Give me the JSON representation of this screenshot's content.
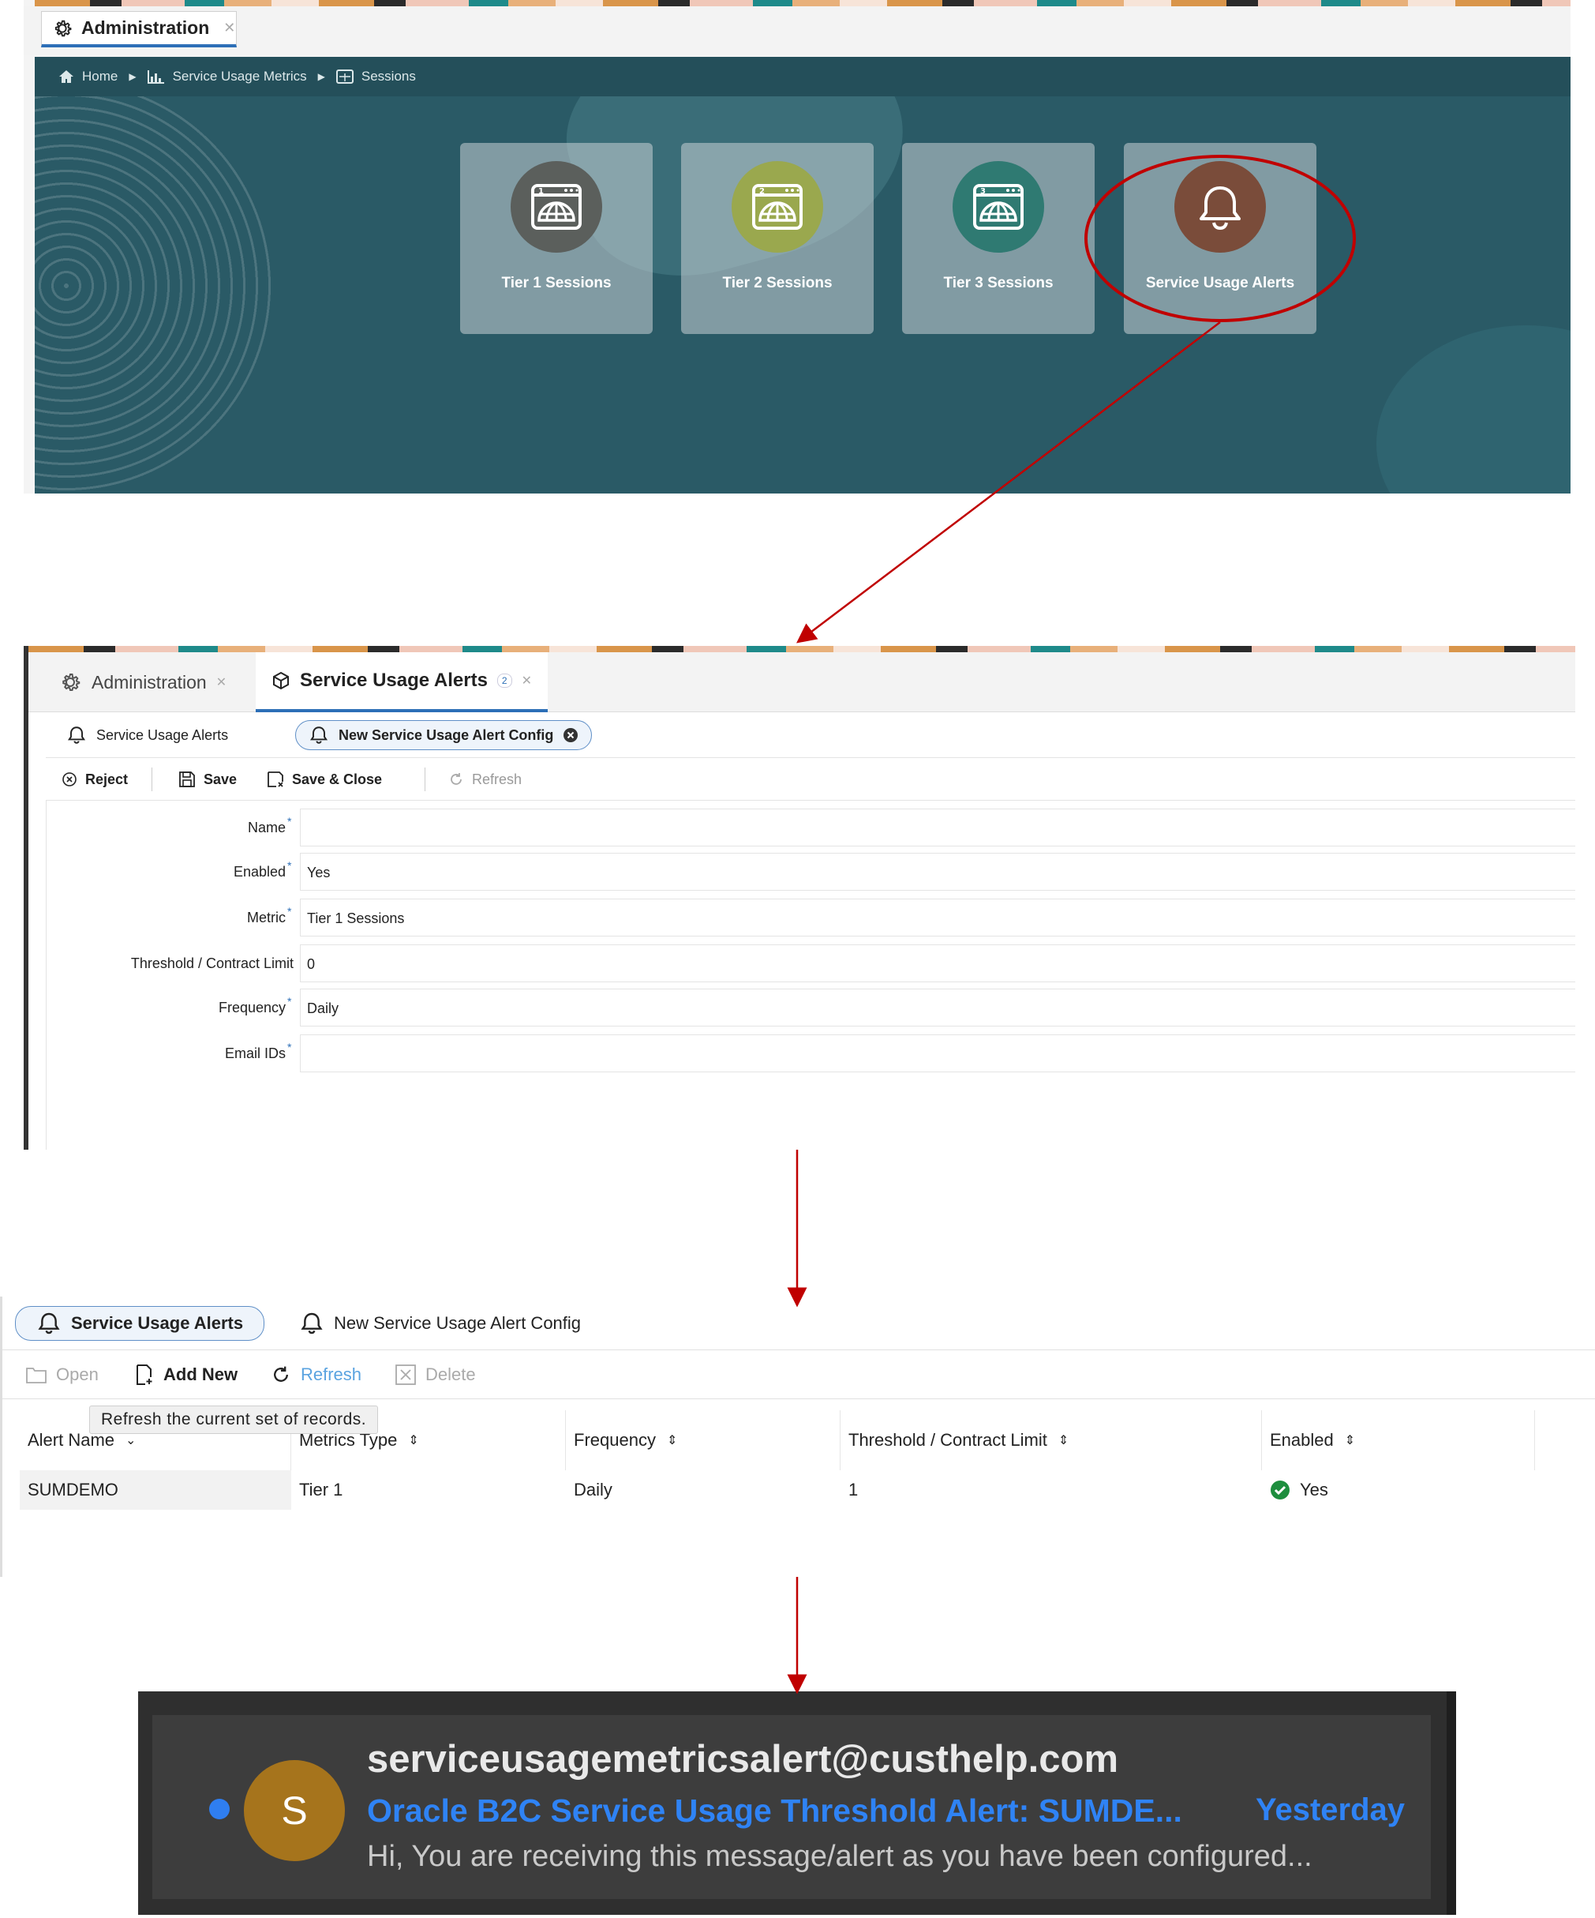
{
  "panel1": {
    "tab_label": "Administration",
    "breadcrumb": [
      "Home",
      "Service Usage Metrics",
      "Sessions"
    ],
    "tiles": [
      {
        "label": "Tier 1 Sessions",
        "color": "#5b5f5c",
        "badge": "1"
      },
      {
        "label": "Tier 2 Sessions",
        "color": "#9aa84e",
        "badge": "2"
      },
      {
        "label": "Tier 3 Sessions",
        "color": "#2f7a72",
        "badge": "3"
      },
      {
        "label": "Service Usage Alerts",
        "color": "#7a4c3a",
        "badge": ""
      }
    ]
  },
  "panel2": {
    "tabs": {
      "admin": "Administration",
      "alerts": "Service Usage Alerts",
      "alerts_count": "2"
    },
    "subtabs": {
      "list": "Service Usage Alerts",
      "new": "New Service Usage Alert Config"
    },
    "toolbar": {
      "reject": "Reject",
      "save": "Save",
      "save_close": "Save & Close",
      "refresh": "Refresh"
    },
    "form": [
      {
        "label": "Name",
        "value": "",
        "required": true
      },
      {
        "label": "Enabled",
        "value": "Yes",
        "required": true
      },
      {
        "label": "Metric",
        "value": "Tier 1 Sessions",
        "required": true
      },
      {
        "label": "Threshold / Contract Limit",
        "value": "0",
        "required": false
      },
      {
        "label": "Frequency",
        "value": "Daily",
        "required": true
      },
      {
        "label": "Email IDs",
        "value": "",
        "required": true
      }
    ]
  },
  "panel3": {
    "subtabs": {
      "list": "Service Usage Alerts",
      "new": "New Service Usage Alert Config"
    },
    "toolbar": {
      "open": "Open",
      "add_new": "Add New",
      "refresh": "Refresh",
      "delete": "Delete"
    },
    "tooltip": "Refresh the current set of records.",
    "columns": [
      "Alert Name",
      "Metrics Type",
      "Frequency",
      "Threshold / Contract Limit",
      "Enabled"
    ],
    "rows": [
      {
        "alert_name": "SUMDEMO",
        "metrics_type": "Tier 1",
        "frequency": "Daily",
        "threshold": "1",
        "enabled": "Yes"
      }
    ]
  },
  "email": {
    "avatar_letter": "S",
    "sender": "serviceusagemetricsalert@custhelp.com",
    "subject": "Oracle B2C Service Usage Threshold Alert: SUMDE...",
    "when": "Yesterday",
    "preview": "Hi, You are receiving this message/alert as you have been configured...",
    "unread_color": "#2f7ef0"
  },
  "colors": {
    "accent_blue": "#2d6fb7",
    "annotation_red": "#c00000",
    "teal_background": "#2a5a66",
    "enabled_green": "#1e8e3e"
  }
}
